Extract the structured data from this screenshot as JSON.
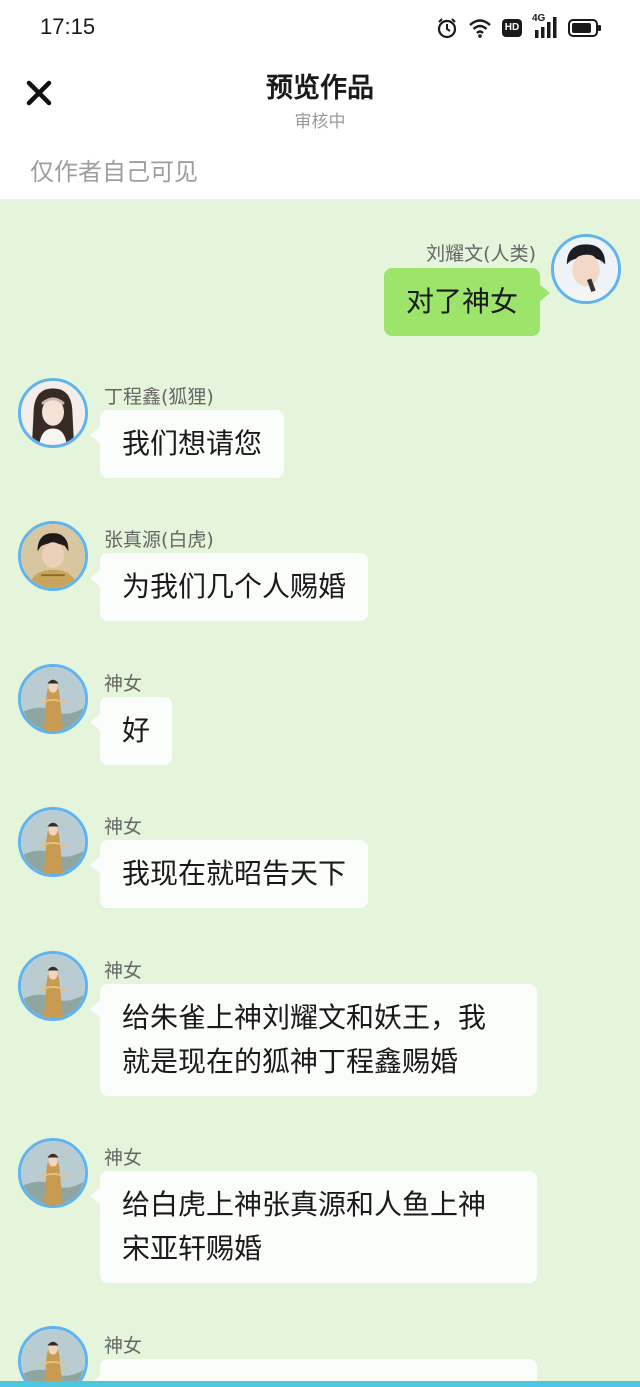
{
  "status_bar": {
    "time": "17:15",
    "icons": [
      "alarm-icon",
      "wifi-icon",
      "hd-icon",
      "signal-4g-icon",
      "battery-icon"
    ],
    "hd_label": "HD",
    "network_label": "4G"
  },
  "header": {
    "close_icon": "close-icon",
    "title": "预览作品",
    "subtitle": "审核中"
  },
  "notice": "仅作者自己可见",
  "messages": [
    {
      "side": "right",
      "sender": "刘耀文(人类)",
      "text": "对了神女",
      "avatar": "liu-yaowen-avatar"
    },
    {
      "side": "left",
      "sender": "丁程鑫(狐狸)",
      "text": "我们想请您",
      "avatar": "ding-chengxin-avatar"
    },
    {
      "side": "left",
      "sender": "张真源(白虎)",
      "text": "为我们几个人赐婚",
      "avatar": "zhang-zhenyuan-avatar"
    },
    {
      "side": "left",
      "sender": "神女",
      "text": "好",
      "avatar": "goddess-avatar"
    },
    {
      "side": "left",
      "sender": "神女",
      "text": "我现在就昭告天下",
      "avatar": "goddess-avatar"
    },
    {
      "side": "left",
      "sender": "神女",
      "text": "给朱雀上神刘耀文和妖王，我就是现在的狐神丁程鑫赐婚",
      "line1": "给朱雀上神刘耀文和妖王，我",
      "line2": "就是现在的狐神丁程鑫赐婚",
      "avatar": "goddess-avatar"
    },
    {
      "side": "left",
      "sender": "神女",
      "text": "给白虎上神张真源和人鱼上神宋亚轩赐婚",
      "line1": "给白虎上神张真源和人鱼上神",
      "line2": "宋亚轩赐婚",
      "avatar": "goddess-avatar"
    },
    {
      "side": "left",
      "sender": "神女",
      "text": "",
      "avatar": "goddess-avatar"
    }
  ],
  "colors": {
    "chat_background": "#e5f5dc",
    "right_bubble": "#9ce46a",
    "left_bubble": "#fbfdfa",
    "avatar_border": "#5fb3ee",
    "bottom_bar": "#4ec6e0"
  }
}
